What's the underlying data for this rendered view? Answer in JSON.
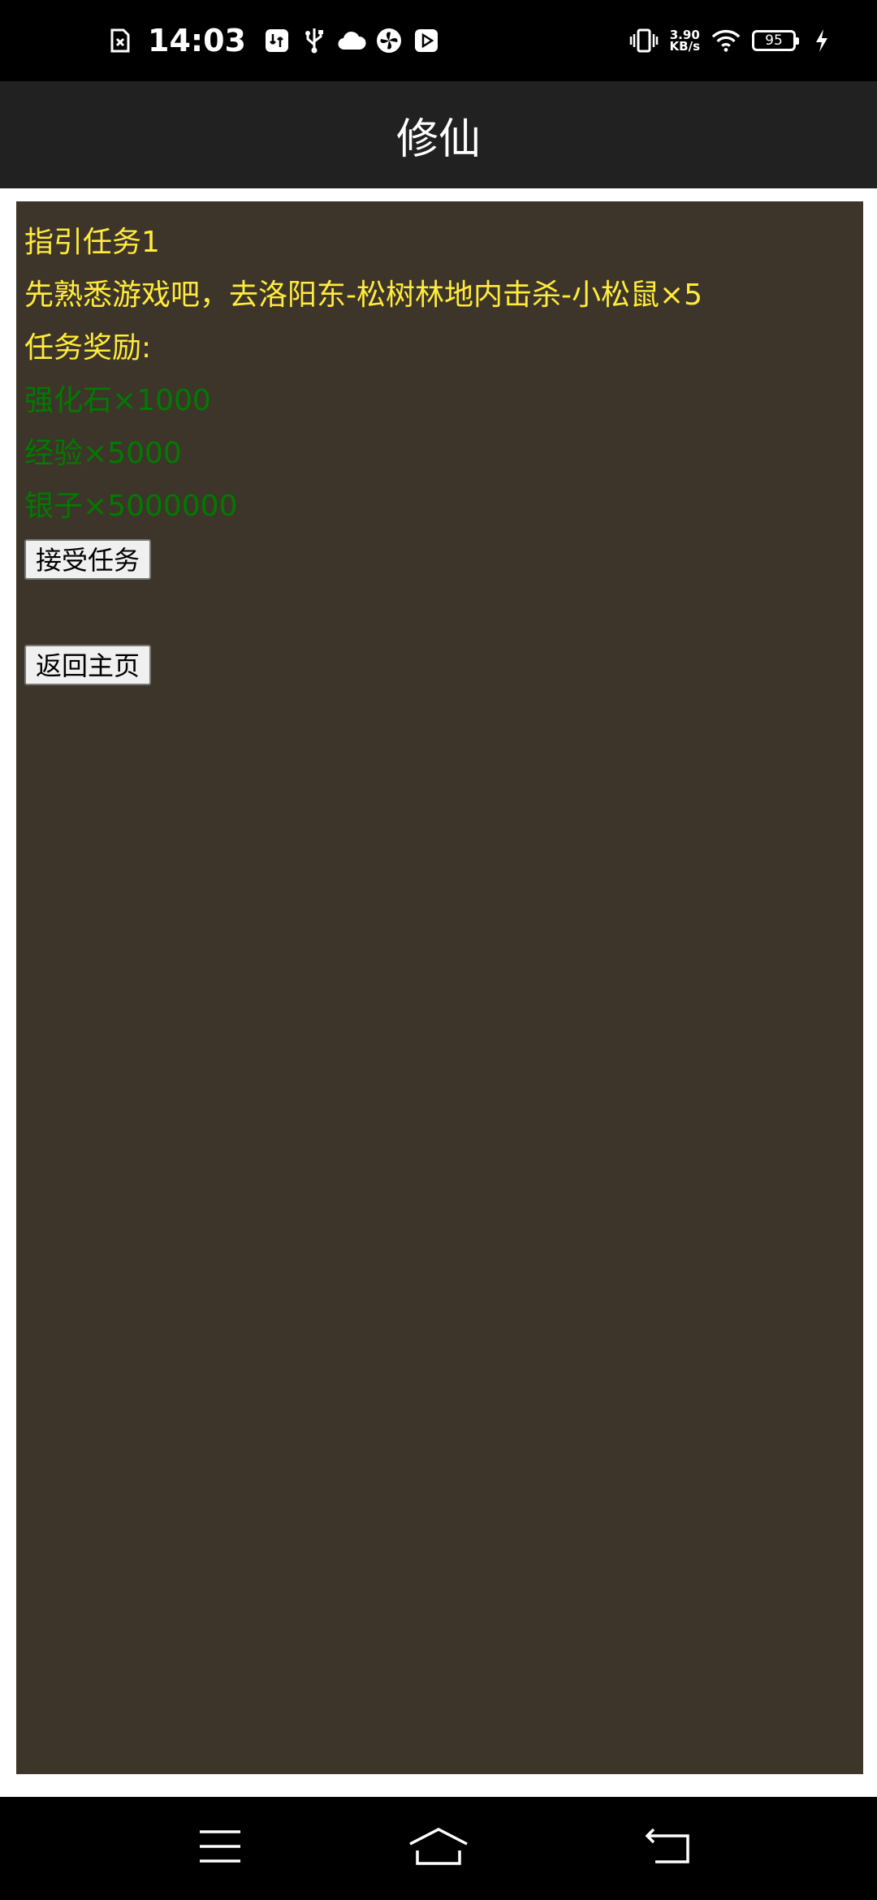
{
  "status_bar": {
    "time": "14:03",
    "net_speed_value": "3.90",
    "net_speed_unit": "KB/s",
    "battery_level": "95",
    "left_icons": [
      "sim-icon",
      "data-saver-icon",
      "usb-icon",
      "cloud-icon",
      "pinwheel-icon",
      "play-icon"
    ],
    "right_icons": [
      "vibrate-icon",
      "wifi-icon",
      "battery-icon",
      "charging-icon"
    ]
  },
  "header": {
    "title": "修仙"
  },
  "quest": {
    "title": "指引任务1",
    "description": "先熟悉游戏吧，去洛阳东-松树林地内击杀-小松鼠×5",
    "rewards_label": "任务奖励:",
    "rewards": [
      "强化石×1000",
      "经验×5000",
      "银子×5000000"
    ],
    "accept_button": "接受任务",
    "home_button": "返回主页"
  },
  "colors": {
    "panel_bg": "#3d3529",
    "quest_text": "#ffeb3b",
    "reward_text": "#007a00",
    "header_bg": "#212121"
  },
  "nav_bar": {
    "buttons": [
      "menu-icon",
      "home-icon",
      "back-icon"
    ]
  }
}
